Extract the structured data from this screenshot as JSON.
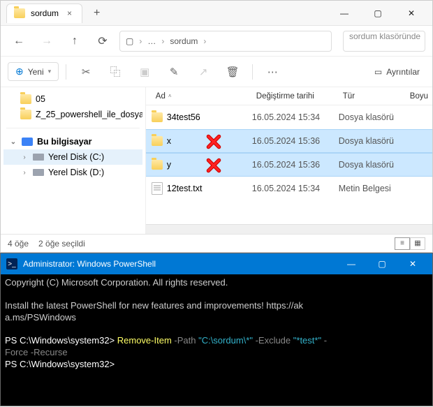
{
  "tab": {
    "folder": "sordum",
    "close": "×",
    "new": "+"
  },
  "win": {
    "min": "—",
    "max": "▢",
    "close": "✕"
  },
  "breadcrumb": {
    "pc": "▢",
    "dots": "…",
    "folder": "sordum"
  },
  "search": {
    "placeholder": "sordum klasöründe"
  },
  "toolbar": {
    "new": "Yeni",
    "details": "Ayrıntılar"
  },
  "sidebar": {
    "items": [
      {
        "name": "05"
      },
      {
        "name": "Z_25_powershell_ile_dosya"
      }
    ],
    "pc": "Bu bilgisayar",
    "drive_c": "Yerel Disk (C:)",
    "drive_d": "Yerel Disk (D:)"
  },
  "columns": {
    "name": "Ad",
    "date": "Değiştirme tarihi",
    "type": "Tür",
    "size": "Boyu"
  },
  "files": [
    {
      "name": "34test56",
      "date": "16.05.2024 15:34",
      "type": "Dosya klasörü",
      "icon": "folder",
      "sel": false,
      "mark": false
    },
    {
      "name": "x",
      "date": "16.05.2024 15:36",
      "type": "Dosya klasörü",
      "icon": "folder",
      "sel": true,
      "mark": true
    },
    {
      "name": "y",
      "date": "16.05.2024 15:36",
      "type": "Dosya klasörü",
      "icon": "folder",
      "sel": true,
      "mark": true
    },
    {
      "name": "12test.txt",
      "date": "16.05.2024 15:34",
      "type": "Metin Belgesi",
      "icon": "text",
      "sel": false,
      "mark": false
    }
  ],
  "status": {
    "count": "4 öğe",
    "selected": "2 öğe seçildi"
  },
  "psh": {
    "title": "Administrator: Windows PowerShell",
    "line1": "Copyright (C) Microsoft Corporation. All rights reserved.",
    "line3a": "Install the latest PowerShell for new features and improvements! https://ak",
    "line3b": "a.ms/PSWindows",
    "prompt1": "PS C:\\Windows\\system32> ",
    "cmd_name": "Remove-Item",
    "cmd_p1": " -Path ",
    "cmd_v1": "\"C:\\sordum\\*\"",
    "cmd_p2": " -Exclude ",
    "cmd_v2": "\"*test*\"",
    "cmd_p3": " -",
    "cmd_line2": "Force -Recurse",
    "prompt2": "PS C:\\Windows\\system32>"
  }
}
